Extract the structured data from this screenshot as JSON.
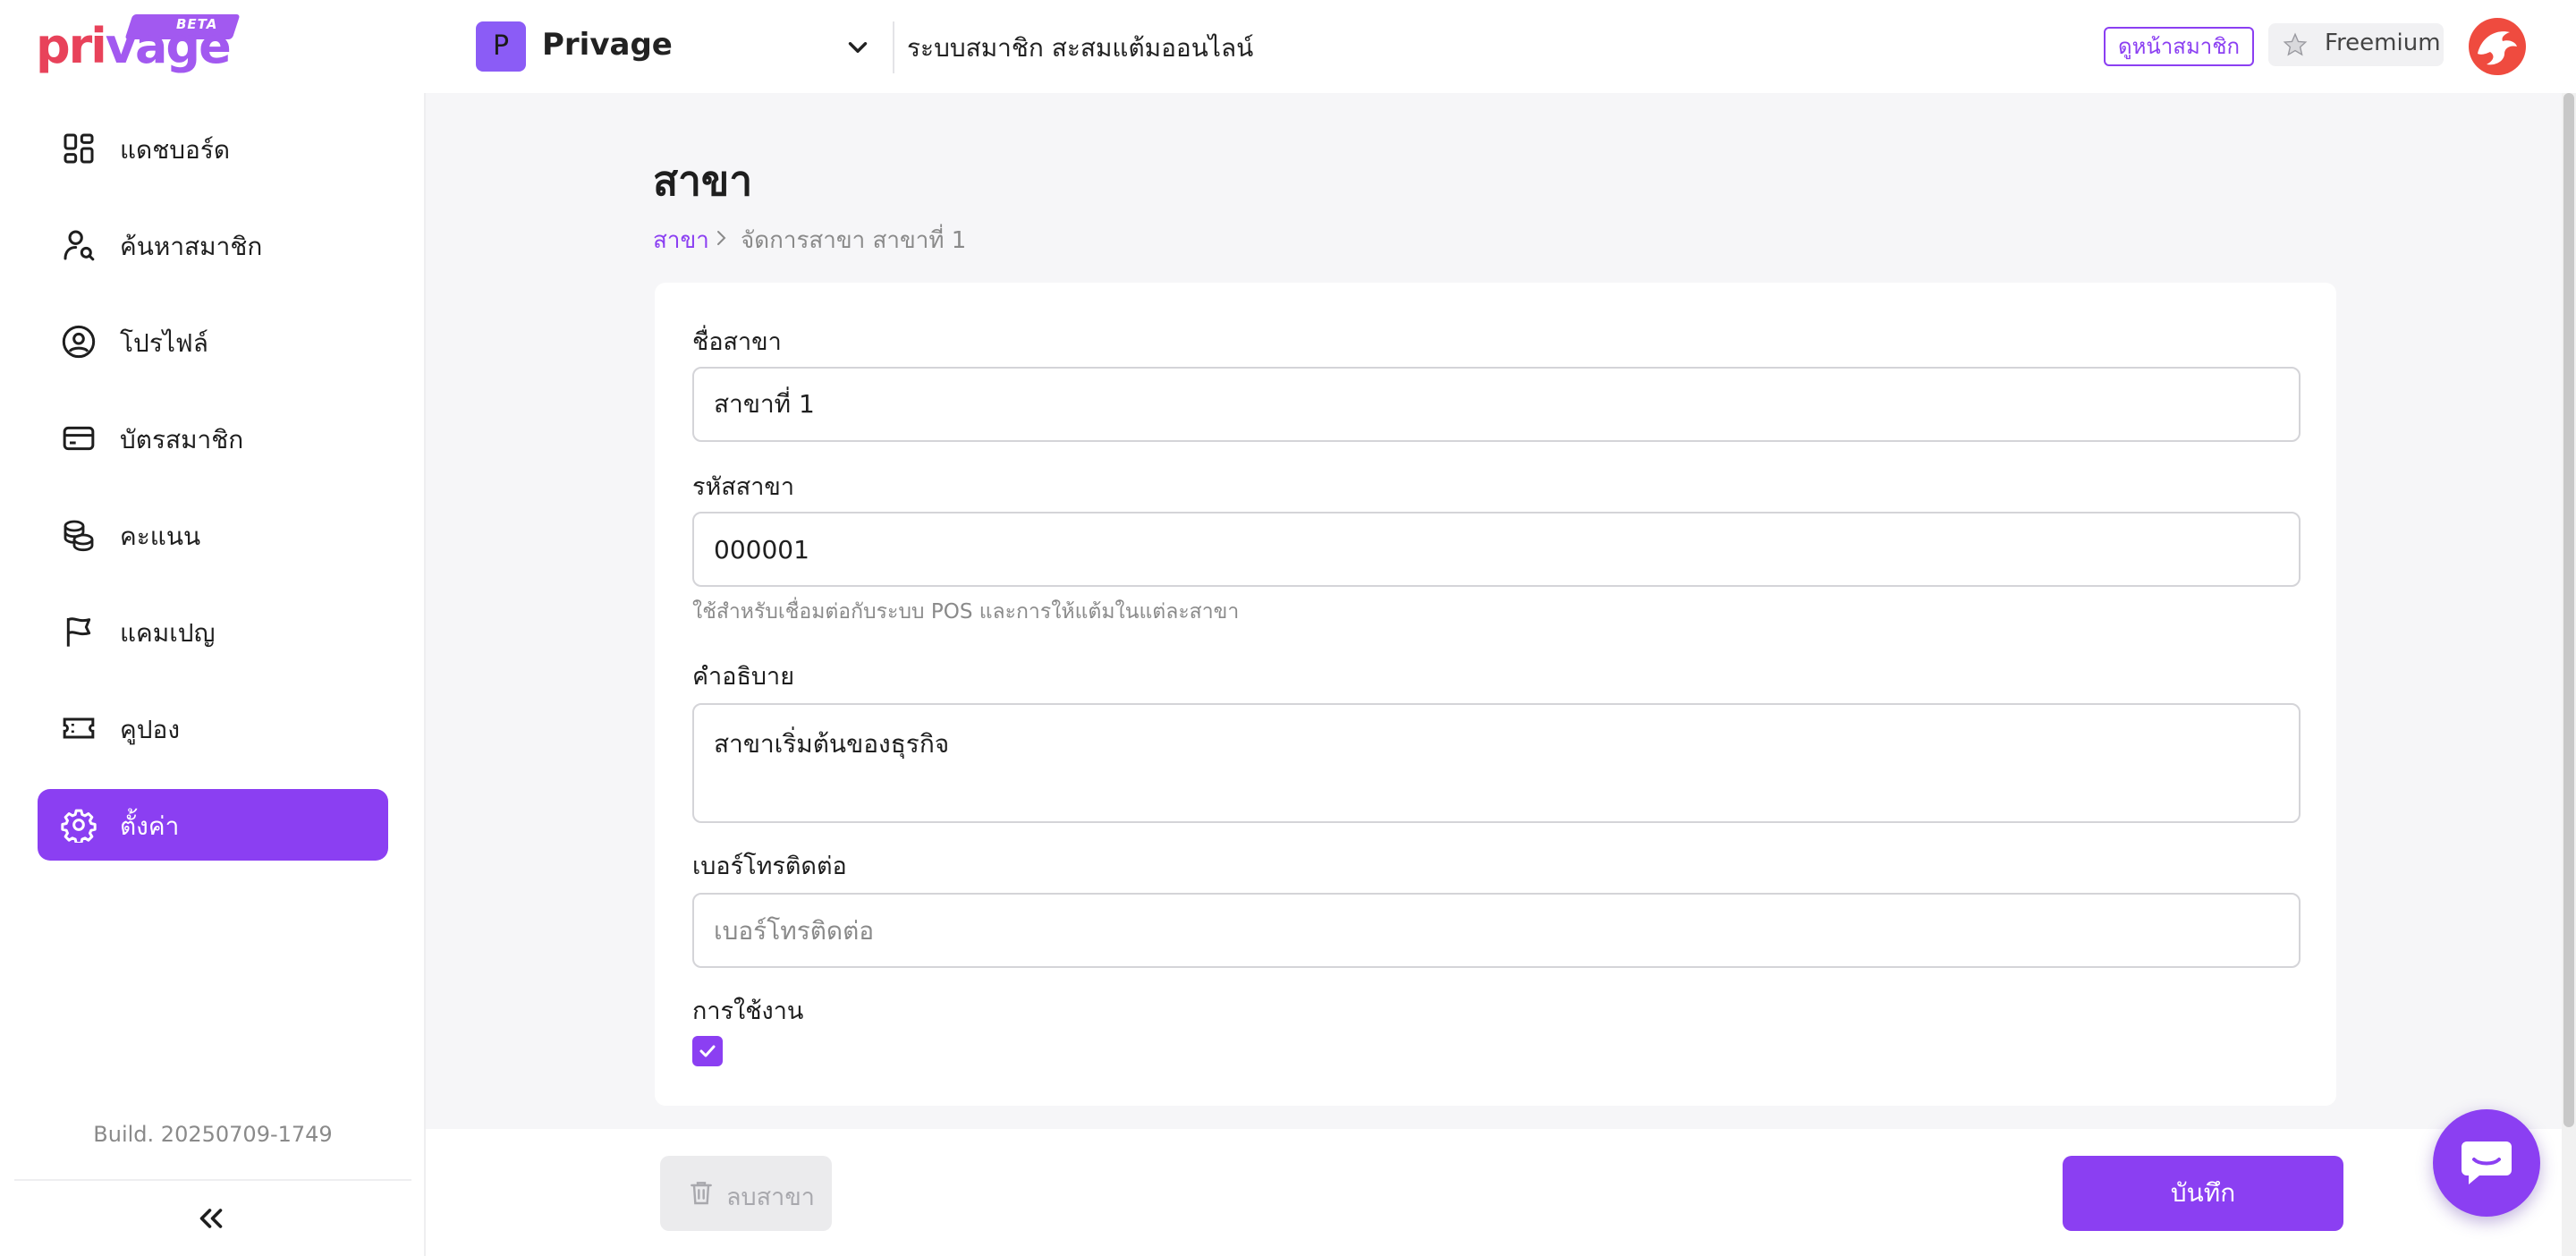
{
  "header": {
    "logo": {
      "text_part1": "pri",
      "text_part2": "vage",
      "badge": "BETA"
    },
    "org": {
      "initial": "P",
      "name": "Privage"
    },
    "app_title": "ระบบสมาชิก สะสมแต้มออนไลน์",
    "view_member_button": "ดูหน้าสมาชิก",
    "plan_badge": "Freemium",
    "user_avatar_icon": "dragon-avatar-icon"
  },
  "sidebar": {
    "items": [
      {
        "label": "แดชบอร์ด",
        "icon": "dashboard-icon",
        "active": false
      },
      {
        "label": "ค้นหาสมาชิก",
        "icon": "user-search-icon",
        "active": false
      },
      {
        "label": "โปรไฟล์",
        "icon": "user-circle-icon",
        "active": false
      },
      {
        "label": "บัตรสมาชิก",
        "icon": "card-icon",
        "active": false
      },
      {
        "label": "คะแนน",
        "icon": "coins-icon",
        "active": false
      },
      {
        "label": "แคมเปญ",
        "icon": "flag-icon",
        "active": false
      },
      {
        "label": "คูปอง",
        "icon": "ticket-icon",
        "active": false
      },
      {
        "label": "ตั้งค่า",
        "icon": "gear-icon",
        "active": true
      }
    ],
    "build": "Build. 20250709-1749",
    "collapse_icon": "chevrons-left-icon"
  },
  "page": {
    "title": "สาขา",
    "breadcrumb": [
      "สาขา",
      "จัดการสาขา สาขาที่ 1"
    ]
  },
  "form": {
    "branch_name": {
      "label": "ชื่อสาขา",
      "value": "สาขาที่ 1"
    },
    "branch_code": {
      "label": "รหัสสาขา",
      "value": "000001",
      "help": "ใช้สำหรับเชื่อมต่อกับระบบ POS และการให้แต้มในแต่ละสาขา"
    },
    "description": {
      "label": "คำอธิบาย",
      "value": "สาขาเริ่มต้นของธุรกิจ"
    },
    "phone": {
      "label": "เบอร์โทรติดต่อ",
      "value": "",
      "placeholder": "เบอร์โทรติดต่อ"
    },
    "active": {
      "label": "การใช้งาน",
      "checked": true
    }
  },
  "actions": {
    "delete_label": "ลบสาขา",
    "save_label": "บันทึก"
  },
  "colors": {
    "accent": "#8b3ff2",
    "logo_red": "#e8425a",
    "avatar_red": "#ef4b3f"
  }
}
